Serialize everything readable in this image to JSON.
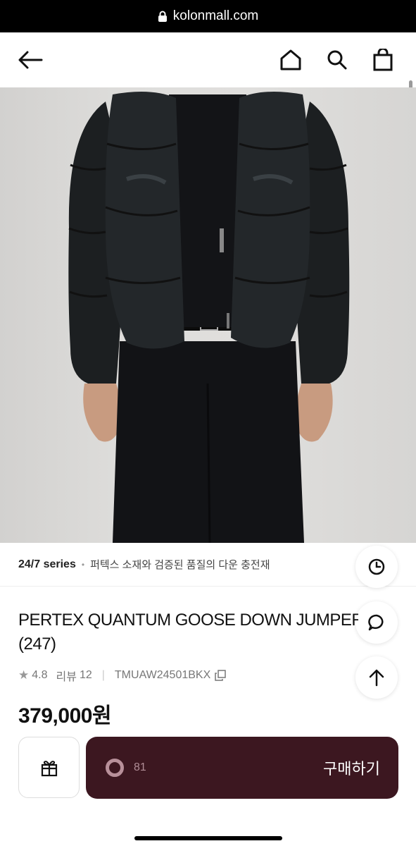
{
  "browser": {
    "url": "kolonmall.com"
  },
  "header": {
    "icons": [
      "back-arrow-icon",
      "home-icon",
      "search-icon",
      "shopping-bag-icon"
    ]
  },
  "product": {
    "series_name": "24/7 series",
    "series_separator": "•",
    "series_desc": "퍼텍스 소재와 검증된 품질의 다운 충전재",
    "title_line1": "PERTEX QUANTUM GOOSE DOWN JUMPER",
    "title_line2": "(247)",
    "rating_star": "★",
    "rating": "4.8",
    "review_label": "리뷰",
    "review_count": "12",
    "meta_separator": "|",
    "product_code": "TMUAW24501BKX",
    "price": "379,000원"
  },
  "floating_buttons": [
    "clock-icon",
    "chat-icon",
    "arrow-up-icon"
  ],
  "purchase_bar": {
    "count": "81",
    "buy_label": "구매하기"
  },
  "colors": {
    "buy_button": "#3c1720",
    "accent_ring": "#b8909a"
  }
}
